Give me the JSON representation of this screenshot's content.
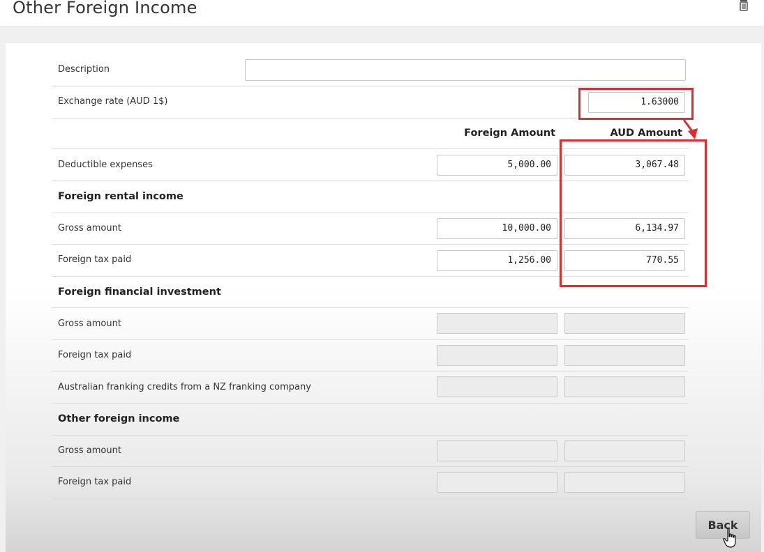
{
  "page": {
    "title": "Other Foreign Income"
  },
  "form": {
    "description_label": "Description",
    "description_value": "",
    "exchange_rate_label": "Exchange rate (AUD 1$)",
    "exchange_rate_value": "1.63000",
    "columns": {
      "foreign": "Foreign Amount",
      "aud": "AUD Amount"
    },
    "deductible": {
      "label": "Deductible expenses",
      "foreign": "5,000.00",
      "aud": "3,067.48"
    },
    "rental": {
      "heading": "Foreign rental income",
      "gross_label": "Gross amount",
      "gross_foreign": "10,000.00",
      "gross_aud": "6,134.97",
      "tax_label": "Foreign tax paid",
      "tax_foreign": "1,256.00",
      "tax_aud": "770.55"
    },
    "financial": {
      "heading": "Foreign financial investment",
      "gross_label": "Gross amount",
      "tax_label": "Foreign tax paid",
      "franking_label": "Australian franking credits from a NZ franking company"
    },
    "other": {
      "heading": "Other foreign income",
      "gross_label": "Gross amount",
      "tax_label": "Foreign tax paid"
    }
  },
  "actions": {
    "back_label": "Back"
  },
  "icons": {
    "delete": "trash-icon",
    "cursor": "hand-pointer-icon"
  },
  "colors": {
    "highlight": "#e32b2b"
  }
}
